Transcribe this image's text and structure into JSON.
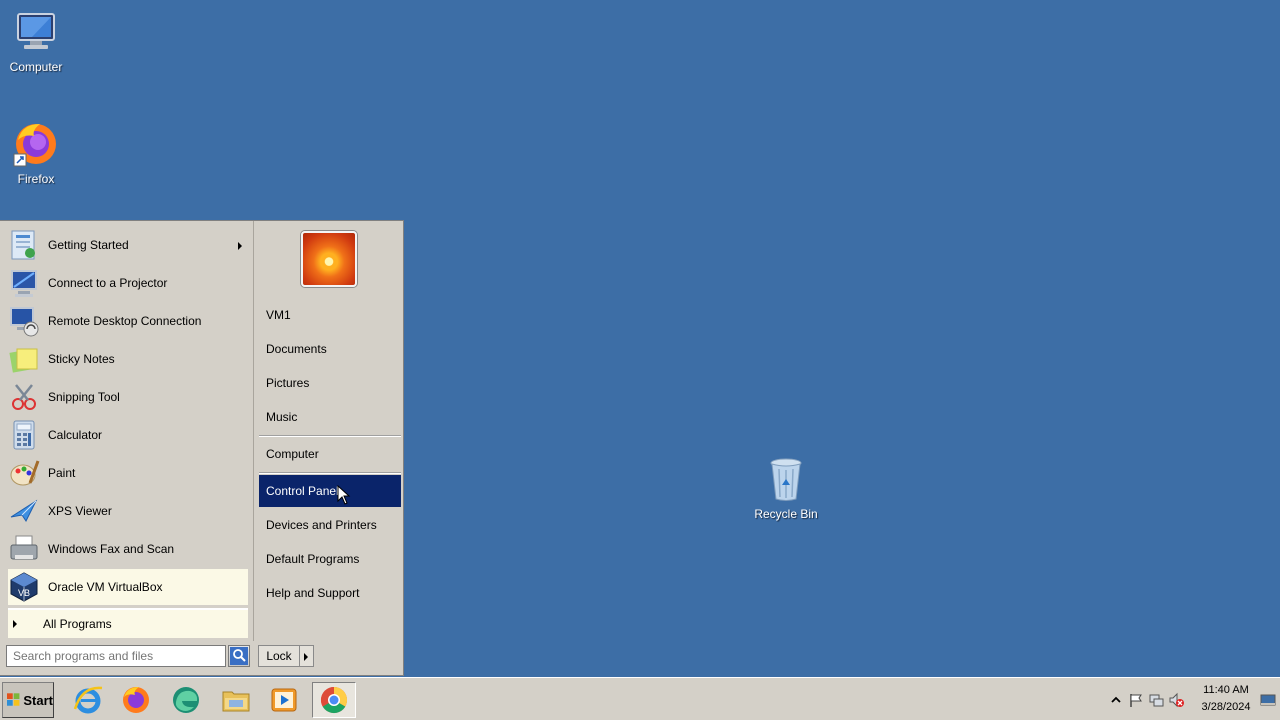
{
  "desktop": {
    "icons": [
      {
        "label": "Computer",
        "icon": "computer-icon"
      },
      {
        "label": "Firefox",
        "icon": "firefox-icon"
      },
      {
        "label": "Recycle Bin",
        "icon": "recycle-bin-icon"
      }
    ]
  },
  "start_menu": {
    "programs": [
      {
        "label": "Getting Started",
        "icon": "getting-started-icon",
        "has_submenu": true
      },
      {
        "label": "Connect to a Projector",
        "icon": "projector-icon"
      },
      {
        "label": "Remote Desktop Connection",
        "icon": "remote-desktop-icon"
      },
      {
        "label": "Sticky Notes",
        "icon": "sticky-notes-icon"
      },
      {
        "label": "Snipping Tool",
        "icon": "snipping-tool-icon"
      },
      {
        "label": "Calculator",
        "icon": "calculator-icon"
      },
      {
        "label": "Paint",
        "icon": "paint-icon"
      },
      {
        "label": "XPS Viewer",
        "icon": "xps-viewer-icon"
      },
      {
        "label": "Windows Fax and Scan",
        "icon": "fax-scan-icon"
      },
      {
        "label": "Oracle VM VirtualBox",
        "icon": "virtualbox-icon",
        "highlighted": true
      }
    ],
    "all_programs_label": "All Programs",
    "search": {
      "placeholder": "Search programs and files"
    },
    "places": [
      {
        "label": "VM1"
      },
      {
        "label": "Documents"
      },
      {
        "label": "Pictures"
      },
      {
        "label": "Music"
      },
      {
        "label": "Computer"
      },
      {
        "label": "Control Panel",
        "selected": true
      },
      {
        "label": "Devices and Printers"
      },
      {
        "label": "Default Programs"
      },
      {
        "label": "Help and Support"
      }
    ],
    "lock_label": "Lock"
  },
  "taskbar": {
    "start_label": "Start",
    "pinned": [
      "internet-explorer-icon",
      "firefox-icon",
      "edge-icon",
      "file-explorer-icon",
      "media-player-icon",
      "chrome-icon"
    ],
    "active_pinned": "chrome-icon",
    "tray": {
      "time": "11:40 AM",
      "date": "3/28/2024",
      "icons": [
        "show-hidden-icons-chevron",
        "action-center-flag-icon",
        "network-icon",
        "volume-muted-icon",
        "show-desktop-icon"
      ]
    }
  }
}
